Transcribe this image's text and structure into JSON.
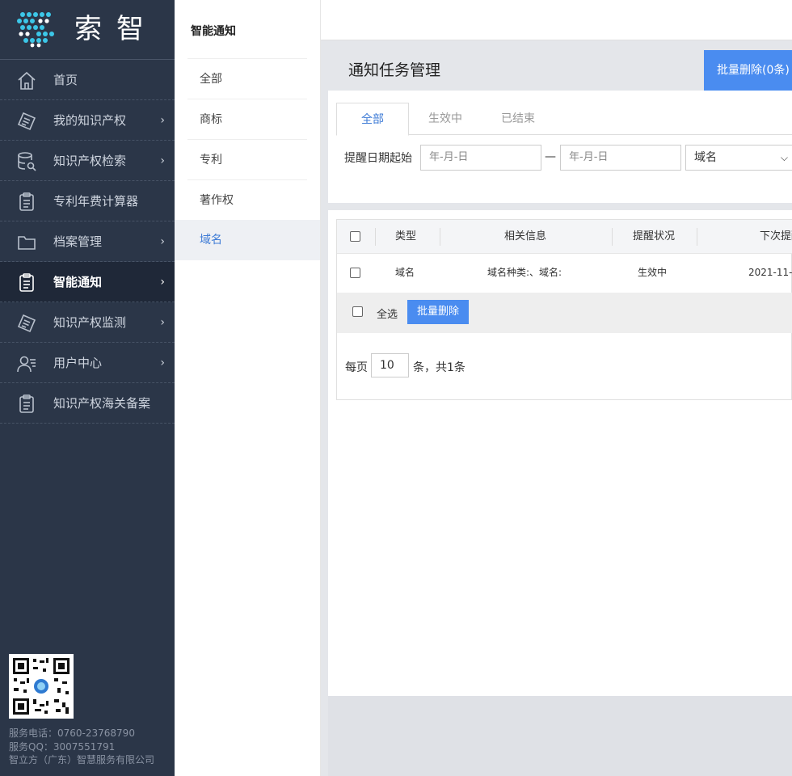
{
  "brand": {
    "name": "索智"
  },
  "sidebar": {
    "items": [
      {
        "label": "首页",
        "icon": "home-icon",
        "arrow": ""
      },
      {
        "label": "我的知识产权",
        "icon": "certificate-icon",
        "arrow": "›"
      },
      {
        "label": "知识产权检索",
        "icon": "database-search-icon",
        "arrow": "›"
      },
      {
        "label": "专利年费计算器",
        "icon": "clipboard-icon",
        "arrow": ""
      },
      {
        "label": "档案管理",
        "icon": "folder-icon",
        "arrow": "›"
      },
      {
        "label": "智能通知",
        "icon": "clipboard-icon",
        "arrow": "›",
        "active": true
      },
      {
        "label": "知识产权监测",
        "icon": "certificate-icon",
        "arrow": "›"
      },
      {
        "label": "用户中心",
        "icon": "user-icon",
        "arrow": "›"
      },
      {
        "label": "知识产权海关备案",
        "icon": "clipboard-icon",
        "arrow": ""
      }
    ],
    "contact": {
      "phone": "服务电话：0760-23768790",
      "qq": "服务QQ：3007551791",
      "company": "智立方（广东）智慧服务有限公司"
    }
  },
  "subnav": {
    "title": "智能通知",
    "items": [
      "全部",
      "商标",
      "专利",
      "著作权",
      "域名"
    ],
    "active_index": 4
  },
  "main": {
    "title": "通知任务管理",
    "batch_delete_top": "批量删除(0条)",
    "tabs": [
      "全部",
      "生效中",
      "已结束"
    ],
    "active_tab": 0,
    "filter": {
      "label": "提醒日期起始",
      "start_placeholder": "年-月-日",
      "separator": "—",
      "end_placeholder": "年-月-日",
      "type_select": "域名"
    },
    "table": {
      "headers": [
        "类型",
        "相关信息",
        "提醒状况",
        "下次提醒"
      ],
      "rows": [
        {
          "type": "域名",
          "info": "域名种类:、域名:",
          "status": "生效中",
          "next": "2021-11-"
        }
      ],
      "select_all": "全选",
      "batch_delete": "批量删除"
    },
    "pager": {
      "per_page_label": "每页",
      "per_page_value": "10",
      "total_text": "条，共1条"
    }
  },
  "colors": {
    "sidebar_bg": "#2b3648",
    "accent": "#4a8cf0",
    "active_text": "#3e7bd6"
  }
}
